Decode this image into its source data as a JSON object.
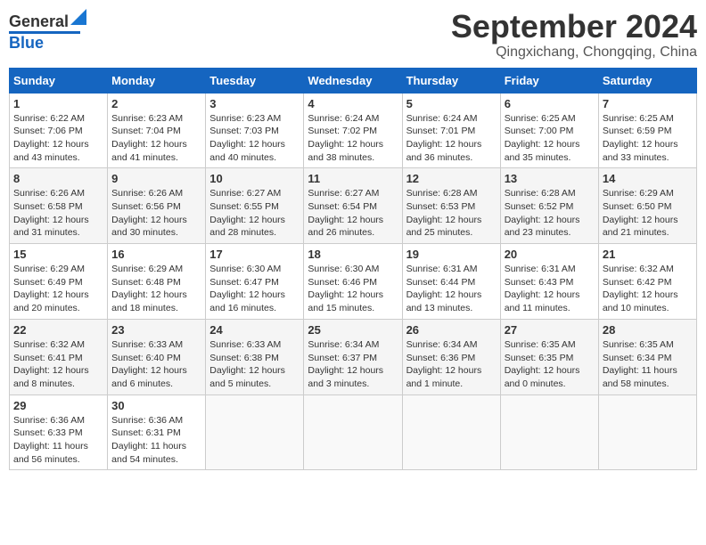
{
  "header": {
    "logo_general": "General",
    "logo_blue": "Blue",
    "month": "September 2024",
    "location": "Qingxichang, Chongqing, China"
  },
  "days_of_week": [
    "Sunday",
    "Monday",
    "Tuesday",
    "Wednesday",
    "Thursday",
    "Friday",
    "Saturday"
  ],
  "weeks": [
    [
      {
        "day": "1",
        "info": "Sunrise: 6:22 AM\nSunset: 7:06 PM\nDaylight: 12 hours\nand 43 minutes."
      },
      {
        "day": "2",
        "info": "Sunrise: 6:23 AM\nSunset: 7:04 PM\nDaylight: 12 hours\nand 41 minutes."
      },
      {
        "day": "3",
        "info": "Sunrise: 6:23 AM\nSunset: 7:03 PM\nDaylight: 12 hours\nand 40 minutes."
      },
      {
        "day": "4",
        "info": "Sunrise: 6:24 AM\nSunset: 7:02 PM\nDaylight: 12 hours\nand 38 minutes."
      },
      {
        "day": "5",
        "info": "Sunrise: 6:24 AM\nSunset: 7:01 PM\nDaylight: 12 hours\nand 36 minutes."
      },
      {
        "day": "6",
        "info": "Sunrise: 6:25 AM\nSunset: 7:00 PM\nDaylight: 12 hours\nand 35 minutes."
      },
      {
        "day": "7",
        "info": "Sunrise: 6:25 AM\nSunset: 6:59 PM\nDaylight: 12 hours\nand 33 minutes."
      }
    ],
    [
      {
        "day": "8",
        "info": "Sunrise: 6:26 AM\nSunset: 6:58 PM\nDaylight: 12 hours\nand 31 minutes."
      },
      {
        "day": "9",
        "info": "Sunrise: 6:26 AM\nSunset: 6:56 PM\nDaylight: 12 hours\nand 30 minutes."
      },
      {
        "day": "10",
        "info": "Sunrise: 6:27 AM\nSunset: 6:55 PM\nDaylight: 12 hours\nand 28 minutes."
      },
      {
        "day": "11",
        "info": "Sunrise: 6:27 AM\nSunset: 6:54 PM\nDaylight: 12 hours\nand 26 minutes."
      },
      {
        "day": "12",
        "info": "Sunrise: 6:28 AM\nSunset: 6:53 PM\nDaylight: 12 hours\nand 25 minutes."
      },
      {
        "day": "13",
        "info": "Sunrise: 6:28 AM\nSunset: 6:52 PM\nDaylight: 12 hours\nand 23 minutes."
      },
      {
        "day": "14",
        "info": "Sunrise: 6:29 AM\nSunset: 6:50 PM\nDaylight: 12 hours\nand 21 minutes."
      }
    ],
    [
      {
        "day": "15",
        "info": "Sunrise: 6:29 AM\nSunset: 6:49 PM\nDaylight: 12 hours\nand 20 minutes."
      },
      {
        "day": "16",
        "info": "Sunrise: 6:29 AM\nSunset: 6:48 PM\nDaylight: 12 hours\nand 18 minutes."
      },
      {
        "day": "17",
        "info": "Sunrise: 6:30 AM\nSunset: 6:47 PM\nDaylight: 12 hours\nand 16 minutes."
      },
      {
        "day": "18",
        "info": "Sunrise: 6:30 AM\nSunset: 6:46 PM\nDaylight: 12 hours\nand 15 minutes."
      },
      {
        "day": "19",
        "info": "Sunrise: 6:31 AM\nSunset: 6:44 PM\nDaylight: 12 hours\nand 13 minutes."
      },
      {
        "day": "20",
        "info": "Sunrise: 6:31 AM\nSunset: 6:43 PM\nDaylight: 12 hours\nand 11 minutes."
      },
      {
        "day": "21",
        "info": "Sunrise: 6:32 AM\nSunset: 6:42 PM\nDaylight: 12 hours\nand 10 minutes."
      }
    ],
    [
      {
        "day": "22",
        "info": "Sunrise: 6:32 AM\nSunset: 6:41 PM\nDaylight: 12 hours\nand 8 minutes."
      },
      {
        "day": "23",
        "info": "Sunrise: 6:33 AM\nSunset: 6:40 PM\nDaylight: 12 hours\nand 6 minutes."
      },
      {
        "day": "24",
        "info": "Sunrise: 6:33 AM\nSunset: 6:38 PM\nDaylight: 12 hours\nand 5 minutes."
      },
      {
        "day": "25",
        "info": "Sunrise: 6:34 AM\nSunset: 6:37 PM\nDaylight: 12 hours\nand 3 minutes."
      },
      {
        "day": "26",
        "info": "Sunrise: 6:34 AM\nSunset: 6:36 PM\nDaylight: 12 hours\nand 1 minute."
      },
      {
        "day": "27",
        "info": "Sunrise: 6:35 AM\nSunset: 6:35 PM\nDaylight: 12 hours\nand 0 minutes."
      },
      {
        "day": "28",
        "info": "Sunrise: 6:35 AM\nSunset: 6:34 PM\nDaylight: 11 hours\nand 58 minutes."
      }
    ],
    [
      {
        "day": "29",
        "info": "Sunrise: 6:36 AM\nSunset: 6:33 PM\nDaylight: 11 hours\nand 56 minutes."
      },
      {
        "day": "30",
        "info": "Sunrise: 6:36 AM\nSunset: 6:31 PM\nDaylight: 11 hours\nand 54 minutes."
      },
      {
        "day": "",
        "info": ""
      },
      {
        "day": "",
        "info": ""
      },
      {
        "day": "",
        "info": ""
      },
      {
        "day": "",
        "info": ""
      },
      {
        "day": "",
        "info": ""
      }
    ]
  ]
}
